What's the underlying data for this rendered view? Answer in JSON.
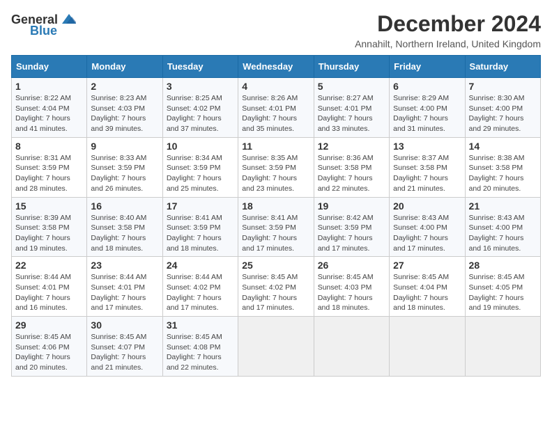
{
  "logo": {
    "general": "General",
    "blue": "Blue"
  },
  "header": {
    "title": "December 2024",
    "subtitle": "Annahilt, Northern Ireland, United Kingdom"
  },
  "weekdays": [
    "Sunday",
    "Monday",
    "Tuesday",
    "Wednesday",
    "Thursday",
    "Friday",
    "Saturday"
  ],
  "weeks": [
    [
      {
        "day": "1",
        "sunrise": "8:22 AM",
        "sunset": "4:04 PM",
        "daylight": "7 hours and 41 minutes."
      },
      {
        "day": "2",
        "sunrise": "8:23 AM",
        "sunset": "4:03 PM",
        "daylight": "7 hours and 39 minutes."
      },
      {
        "day": "3",
        "sunrise": "8:25 AM",
        "sunset": "4:02 PM",
        "daylight": "7 hours and 37 minutes."
      },
      {
        "day": "4",
        "sunrise": "8:26 AM",
        "sunset": "4:01 PM",
        "daylight": "7 hours and 35 minutes."
      },
      {
        "day": "5",
        "sunrise": "8:27 AM",
        "sunset": "4:01 PM",
        "daylight": "7 hours and 33 minutes."
      },
      {
        "day": "6",
        "sunrise": "8:29 AM",
        "sunset": "4:00 PM",
        "daylight": "7 hours and 31 minutes."
      },
      {
        "day": "7",
        "sunrise": "8:30 AM",
        "sunset": "4:00 PM",
        "daylight": "7 hours and 29 minutes."
      }
    ],
    [
      {
        "day": "8",
        "sunrise": "8:31 AM",
        "sunset": "3:59 PM",
        "daylight": "7 hours and 28 minutes."
      },
      {
        "day": "9",
        "sunrise": "8:33 AM",
        "sunset": "3:59 PM",
        "daylight": "7 hours and 26 minutes."
      },
      {
        "day": "10",
        "sunrise": "8:34 AM",
        "sunset": "3:59 PM",
        "daylight": "7 hours and 25 minutes."
      },
      {
        "day": "11",
        "sunrise": "8:35 AM",
        "sunset": "3:59 PM",
        "daylight": "7 hours and 23 minutes."
      },
      {
        "day": "12",
        "sunrise": "8:36 AM",
        "sunset": "3:58 PM",
        "daylight": "7 hours and 22 minutes."
      },
      {
        "day": "13",
        "sunrise": "8:37 AM",
        "sunset": "3:58 PM",
        "daylight": "7 hours and 21 minutes."
      },
      {
        "day": "14",
        "sunrise": "8:38 AM",
        "sunset": "3:58 PM",
        "daylight": "7 hours and 20 minutes."
      }
    ],
    [
      {
        "day": "15",
        "sunrise": "8:39 AM",
        "sunset": "3:58 PM",
        "daylight": "7 hours and 19 minutes."
      },
      {
        "day": "16",
        "sunrise": "8:40 AM",
        "sunset": "3:58 PM",
        "daylight": "7 hours and 18 minutes."
      },
      {
        "day": "17",
        "sunrise": "8:41 AM",
        "sunset": "3:59 PM",
        "daylight": "7 hours and 18 minutes."
      },
      {
        "day": "18",
        "sunrise": "8:41 AM",
        "sunset": "3:59 PM",
        "daylight": "7 hours and 17 minutes."
      },
      {
        "day": "19",
        "sunrise": "8:42 AM",
        "sunset": "3:59 PM",
        "daylight": "7 hours and 17 minutes."
      },
      {
        "day": "20",
        "sunrise": "8:43 AM",
        "sunset": "4:00 PM",
        "daylight": "7 hours and 17 minutes."
      },
      {
        "day": "21",
        "sunrise": "8:43 AM",
        "sunset": "4:00 PM",
        "daylight": "7 hours and 16 minutes."
      }
    ],
    [
      {
        "day": "22",
        "sunrise": "8:44 AM",
        "sunset": "4:01 PM",
        "daylight": "7 hours and 16 minutes."
      },
      {
        "day": "23",
        "sunrise": "8:44 AM",
        "sunset": "4:01 PM",
        "daylight": "7 hours and 17 minutes."
      },
      {
        "day": "24",
        "sunrise": "8:44 AM",
        "sunset": "4:02 PM",
        "daylight": "7 hours and 17 minutes."
      },
      {
        "day": "25",
        "sunrise": "8:45 AM",
        "sunset": "4:02 PM",
        "daylight": "7 hours and 17 minutes."
      },
      {
        "day": "26",
        "sunrise": "8:45 AM",
        "sunset": "4:03 PM",
        "daylight": "7 hours and 18 minutes."
      },
      {
        "day": "27",
        "sunrise": "8:45 AM",
        "sunset": "4:04 PM",
        "daylight": "7 hours and 18 minutes."
      },
      {
        "day": "28",
        "sunrise": "8:45 AM",
        "sunset": "4:05 PM",
        "daylight": "7 hours and 19 minutes."
      }
    ],
    [
      {
        "day": "29",
        "sunrise": "8:45 AM",
        "sunset": "4:06 PM",
        "daylight": "7 hours and 20 minutes."
      },
      {
        "day": "30",
        "sunrise": "8:45 AM",
        "sunset": "4:07 PM",
        "daylight": "7 hours and 21 minutes."
      },
      {
        "day": "31",
        "sunrise": "8:45 AM",
        "sunset": "4:08 PM",
        "daylight": "7 hours and 22 minutes."
      },
      null,
      null,
      null,
      null
    ]
  ],
  "labels": {
    "sunrise": "Sunrise:",
    "sunset": "Sunset:",
    "daylight": "Daylight:"
  }
}
